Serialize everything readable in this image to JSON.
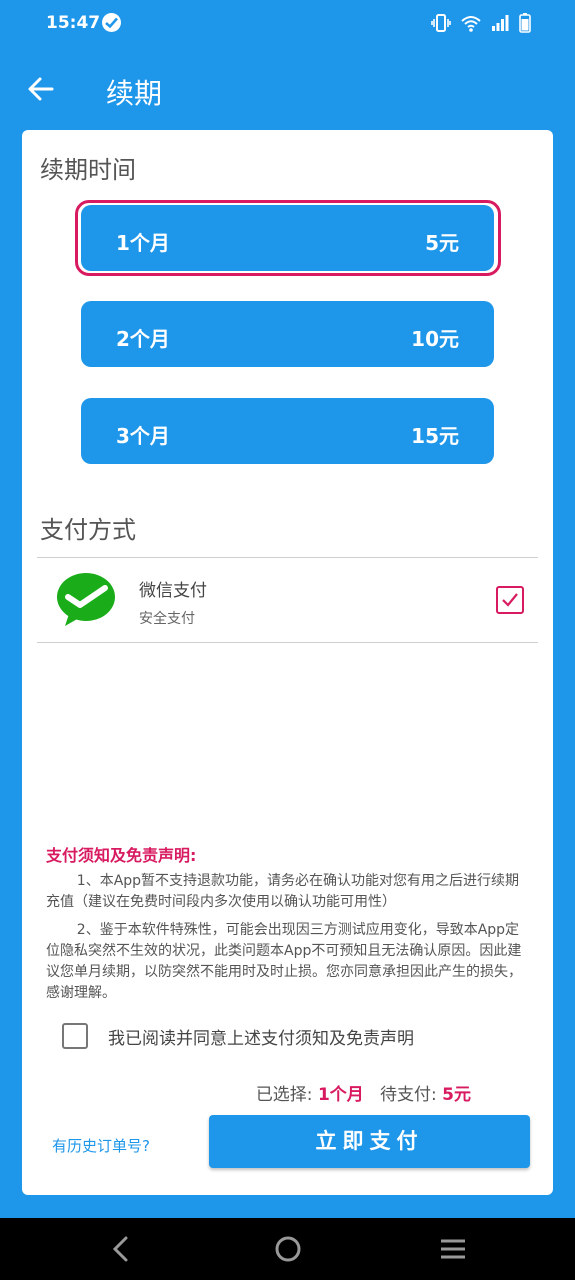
{
  "status_bar": {
    "time": "15:47",
    "icons": [
      "check-circle-icon",
      "vibrate-icon",
      "wifi-icon",
      "signal-icon",
      "battery-icon"
    ]
  },
  "app_bar": {
    "title": "续期",
    "back_icon": "arrow-left-icon"
  },
  "renewal": {
    "section_title": "续期时间",
    "plans": [
      {
        "label": "1个月",
        "price": "5元",
        "selected": true
      },
      {
        "label": "2个月",
        "price": "10元",
        "selected": false
      },
      {
        "label": "3个月",
        "price": "15元",
        "selected": false
      }
    ]
  },
  "payment": {
    "section_title": "支付方式",
    "method": {
      "name": "微信支付",
      "subtitle": "安全支付",
      "icon": "wechat-icon",
      "checked": true
    }
  },
  "notice": {
    "title": "支付须知及免责声明:",
    "p1": "1、本App暂不支持退款功能，请务必在确认功能对您有用之后进行续期充值（建议在免费时间段内多次使用以确认功能可用性）",
    "p2": "2、鉴于本软件特殊性，可能会出现因三方测试应用变化，导致本App定位隐私突然不生效的状况，此类问题本App不可预知且无法确认原因。因此建议您单月续期，以防突然不能用时及时止损。您亦同意承担因此产生的损失，感谢理解。"
  },
  "agreement": {
    "label": "我已阅读并同意上述支付须知及免责声明",
    "checked": false
  },
  "summary": {
    "selected_label": "已选择:",
    "selected_value": "1个月",
    "pending_label": "待支付:",
    "pending_value": "5元"
  },
  "footer": {
    "history_link": "有历史订单号?",
    "pay_button": "立即支付"
  },
  "nav_bar": {
    "icons": [
      "back-triangle-icon",
      "home-circle-icon",
      "menu-lines-icon"
    ]
  },
  "colors": {
    "primary": "#1e96ea",
    "accent": "#d81b60",
    "wechat_green": "#1aad19"
  }
}
